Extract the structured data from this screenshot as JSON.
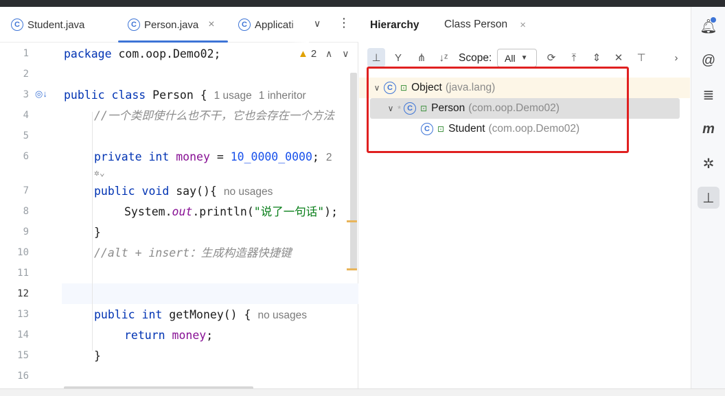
{
  "editor": {
    "tabs": [
      {
        "label": "Student.java"
      },
      {
        "label": "Person.java",
        "close": "×"
      },
      {
        "label": "Applicati"
      }
    ],
    "warning_count": "2",
    "line_numbers": [
      "1",
      "2",
      "3",
      "4",
      "5",
      "6",
      "7",
      "8",
      "9",
      "10",
      "11",
      "12",
      "13",
      "14",
      "15",
      "16"
    ],
    "lines": {
      "l1_kw": "package",
      "l1_rest": " com.oop.Demo02;",
      "l3_kw": "public class",
      "l3_rest": " Person {",
      "l3_hint1": "1 usage",
      "l3_hint2": "1 inheritor",
      "l4_comment": "//一个类即使什么也不干，它也会存在一个方法",
      "l6_kw": "private int",
      "l6_field": " money",
      "l6_eq": " = ",
      "l6_num": "10_0000_0000",
      "l6_semi": ";",
      "l6_hint": "2",
      "l7_kw": "public void",
      "l7_rest": " say(){",
      "l7_hint": "no usages",
      "l8_a": "System.",
      "l8_out": "out",
      "l8_b": ".println(",
      "l8_str": "\"说了一句话\"",
      "l8_c": ");",
      "l9": "}",
      "l10_comment": "//alt + insert：生成构造器快捷键",
      "l13_kw": "public int",
      "l13_rest": " getMoney() {",
      "l13_hint": "no usages",
      "l14_kw": "return",
      "l14_field": " money",
      "l14_semi": ";",
      "l15": "}"
    }
  },
  "hierarchy": {
    "title": "Hierarchy",
    "class_tab": "Class Person",
    "class_tab_close": "×",
    "scope_label": "Scope:",
    "scope_value": "All",
    "tree": [
      {
        "name": "Object",
        "package": "(java.lang)"
      },
      {
        "name": "Person",
        "package": "(com.oop.Demo02)"
      },
      {
        "name": "Student",
        "package": "(com.oop.Demo02)"
      }
    ]
  },
  "colors": {
    "accent": "#3d74d6",
    "highlight_box": "#e02020"
  },
  "icons": {
    "class": "C"
  }
}
